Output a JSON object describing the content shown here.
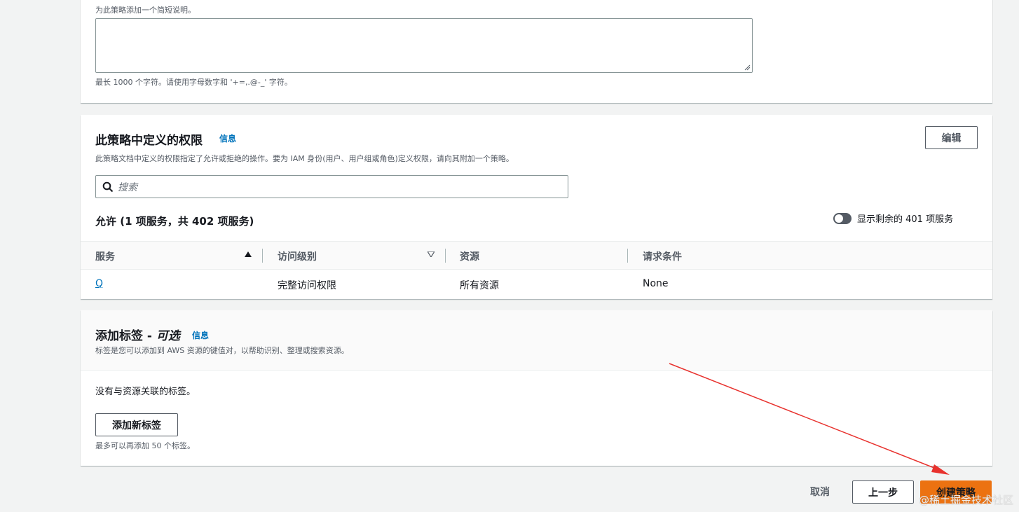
{
  "description": {
    "hint_top": "为此策略添加一个简短说明。",
    "value": "",
    "hint_bottom": "最长 1000 个字符。请使用字母数字和 '+=,.@-_' 字符。"
  },
  "permissions": {
    "title": "此策略中定义的权限",
    "info": "信息",
    "subtitle": "此策略文档中定义的权限指定了允许或拒绝的操作。要为 IAM 身份(用户、用户组或角色)定义权限，请向其附加一个策略。",
    "edit_label": "编辑",
    "search_placeholder": "搜索",
    "allow_heading": "允许 (1 项服务，共 402 项服务)",
    "toggle_label": "显示剩余的 401 项服务",
    "columns": [
      "服务",
      "访问级别",
      "资源",
      "请求条件"
    ],
    "rows": [
      {
        "service": "Q",
        "access": "完整访问权限",
        "resource": "所有资源",
        "condition": "None"
      }
    ]
  },
  "tags": {
    "title": "添加标签 - ",
    "title_optional": "可选",
    "info": "信息",
    "subtitle": "标签是您可以添加到 AWS 资源的键值对，以帮助识别、整理或搜索资源。",
    "empty_text": "没有与资源关联的标签。",
    "add_label": "添加新标签",
    "limit_text": "最多可以再添加 50 个标签。"
  },
  "footer": {
    "cancel_label": "取消",
    "previous_label": "上一步",
    "create_label": "创建策略"
  },
  "watermark": "@稀土掘金技术社区",
  "colors": {
    "accent": "#ec7211",
    "link": "#0073bb",
    "annotation_arrow": "#e8322e"
  }
}
